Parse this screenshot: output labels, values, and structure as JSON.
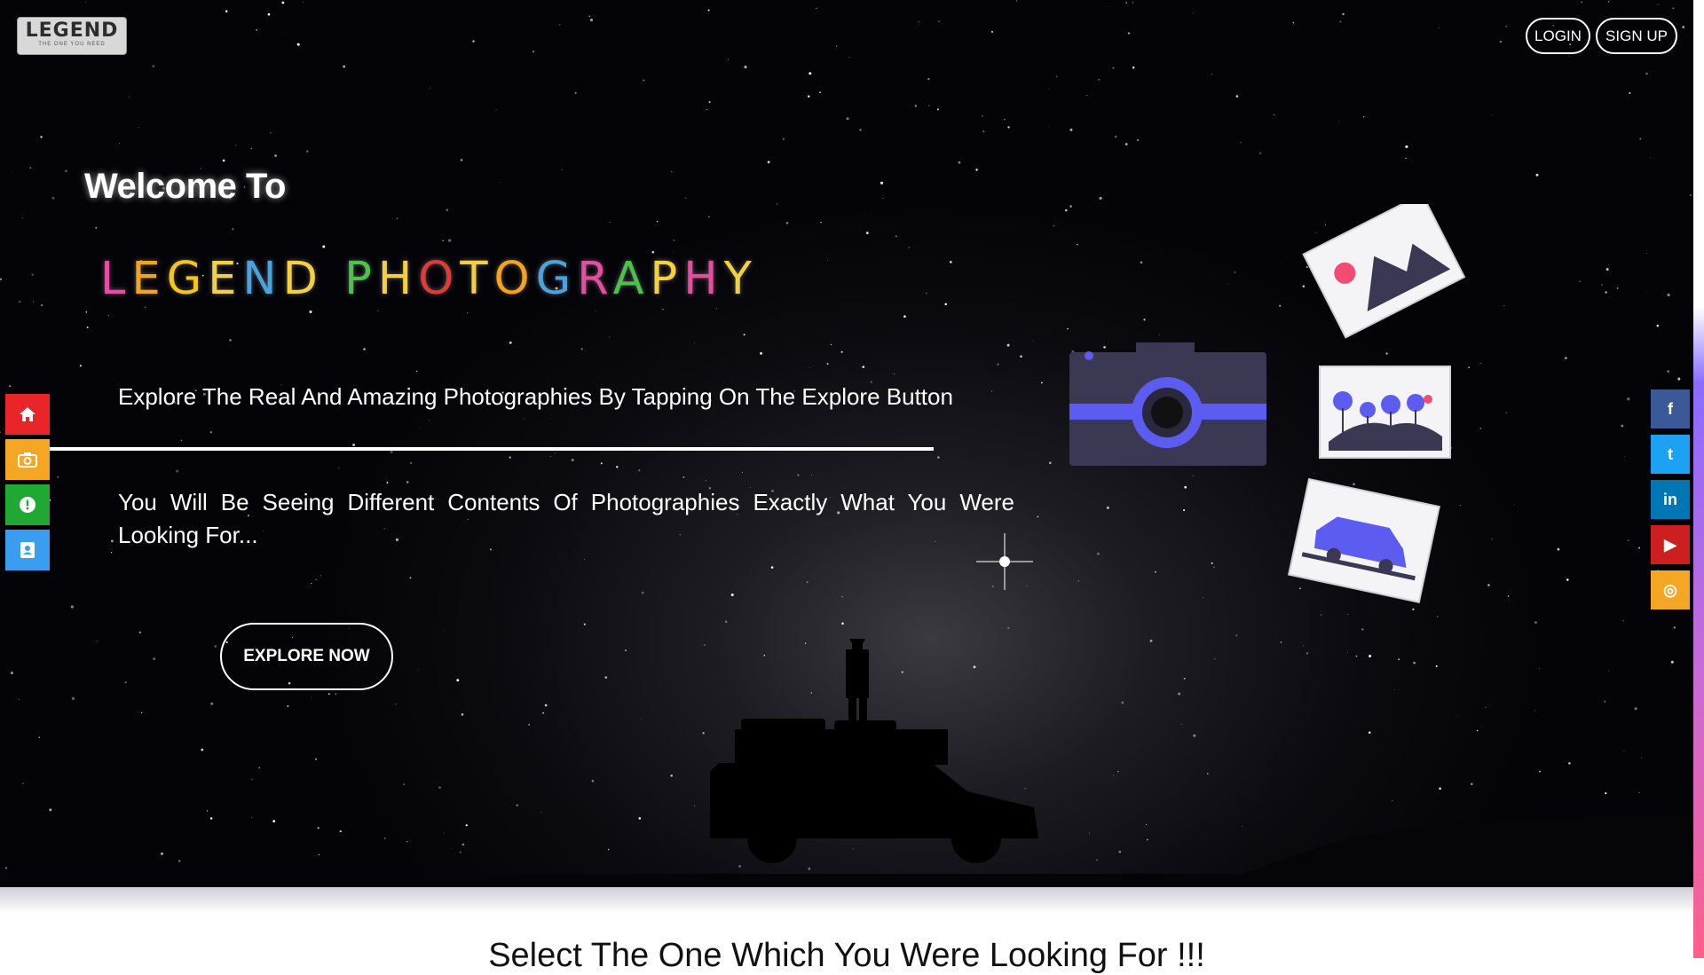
{
  "header": {
    "logo_text": "LEGEND",
    "logo_tagline": "THE ONE YOU NEED",
    "login_label": "LOGIN",
    "signup_label": "SIGN UP"
  },
  "hero": {
    "welcome": "Welcome To",
    "brand": {
      "letters": [
        "L",
        "E",
        "G",
        "E",
        "N",
        "D",
        " ",
        "P",
        "H",
        "O",
        "T",
        "O",
        "G",
        "R",
        "A",
        "P",
        "H",
        "Y"
      ],
      "colors": [
        "#e84ba0",
        "#f7a21b",
        "#f5c518",
        "#f4d03f",
        "#4aa3df",
        "#f4d03f",
        "#ffffff",
        "#4cc24a",
        "#f4d03f",
        "#e53935",
        "#f4d03f",
        "#f7a21b",
        "#4aa3df",
        "#e84ba0",
        "#4cc24a",
        "#f4d03f",
        "#e84ba0",
        "#f4d03f"
      ]
    },
    "explore_text": "Explore The Real And Amazing Photographies By Tapping On The Explore Button",
    "description": "You Will Be Seeing Different Contents Of Photographies Exactly What You Were Looking For...",
    "explore_button": "EXPLORE NOW"
  },
  "left_sidebar": [
    {
      "name": "home-icon",
      "color": "#e8262a"
    },
    {
      "name": "camera-icon",
      "color": "#f5a623"
    },
    {
      "name": "info-icon",
      "color": "#1fa832"
    },
    {
      "name": "contact-icon",
      "color": "#3b9df0"
    }
  ],
  "social_sidebar": [
    {
      "name": "facebook-icon",
      "glyph": "f",
      "color": "#3b5998"
    },
    {
      "name": "twitter-icon",
      "glyph": "t",
      "color": "#1da1f2"
    },
    {
      "name": "linkedin-icon",
      "glyph": "in",
      "color": "#0077b5"
    },
    {
      "name": "youtube-icon",
      "glyph": "▶",
      "color": "#cc1f1f"
    },
    {
      "name": "instagram-icon",
      "glyph": "◎",
      "color": "#f5a623"
    }
  ],
  "section": {
    "title": "Select The One Which You Were Looking For !!!"
  },
  "colors": {
    "illustration_accent": "#5c5cf0",
    "illustration_dark": "#3a3852",
    "illustration_pink": "#f14c72"
  }
}
